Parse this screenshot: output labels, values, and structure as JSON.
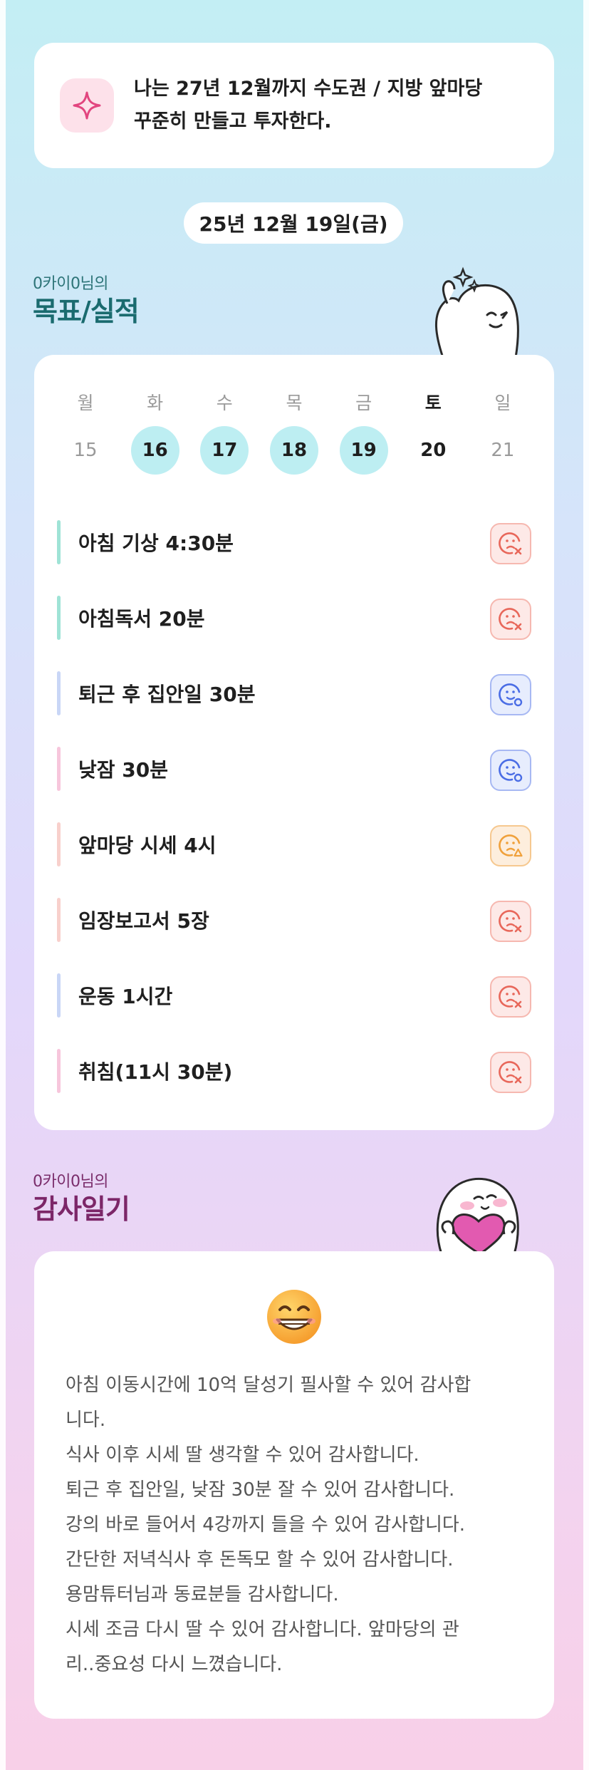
{
  "goal": {
    "icon": "sparkle-icon",
    "lines": [
      "나는 27년 12월까지 수도권 / 지방 앞마당",
      "꾸준히 만들고 투자한다."
    ]
  },
  "date_label": "25년 12월 19일(금)",
  "goals_section": {
    "user_label": "0카이0님의",
    "title": "목표/실적",
    "weekdays": [
      "월",
      "화",
      "수",
      "목",
      "금",
      "토",
      "일"
    ],
    "dates": [
      "15",
      "16",
      "17",
      "18",
      "19",
      "20",
      "21"
    ],
    "tasks": [
      {
        "label": "아침 기상 4:30분",
        "status": "fail-face-icon",
        "bar_color": "#9fe3d6"
      },
      {
        "label": "아침독서 20분",
        "status": "fail-face-icon",
        "bar_color": "#9fe3d6"
      },
      {
        "label": "퇴근 후 집안일 30분",
        "status": "ok-face-icon",
        "bar_color": "#c9d6f6"
      },
      {
        "label": "낮잠 30분",
        "status": "ok-face-icon",
        "bar_color": "#f7c6dc"
      },
      {
        "label": "앞마당 시세 4시",
        "status": "warn-face-icon",
        "bar_color": "#f8d0cc"
      },
      {
        "label": "임장보고서 5장",
        "status": "fail-face-icon",
        "bar_color": "#f8d0cc"
      },
      {
        "label": "운동 1시간",
        "status": "fail-face-icon",
        "bar_color": "#c9d6f6"
      },
      {
        "label": "취침(11시 30분)",
        "status": "fail-face-icon",
        "bar_color": "#f7c6dc"
      }
    ]
  },
  "gratitude_section": {
    "user_label": "0카이0님의",
    "title": "감사일기",
    "emoji": "grinning-face-icon",
    "lines": [
      "아침 이동시간에 10억 달성기 필사할 수 있어 감사합",
      "니다.",
      "식사 이후 시세 딸 생각할 수 있어 감사합니다.",
      "퇴근 후 집안일, 낮잠 30분 잘 수 있어 감사합니다.",
      "강의 바로 들어서 4강까지 들을 수 있어 감사합니다.",
      "간단한 저녁식사 후 돈독모 할 수 있어 감사합니다.",
      "용맘튜터님과 동료분들 감사합니다.",
      "시세 조금 다시 딸 수 있어 감사합니다. 앞마당의 관",
      "리..중요성 다시 느꼈습니다."
    ]
  },
  "colors": {
    "accent_teal": "#1a6b6f",
    "accent_plum": "#7c2668",
    "done_circle": "#bdeef2",
    "fail_icon": "#e8675a",
    "ok_icon": "#4a6de5",
    "warn_icon": "#f0a13b"
  }
}
